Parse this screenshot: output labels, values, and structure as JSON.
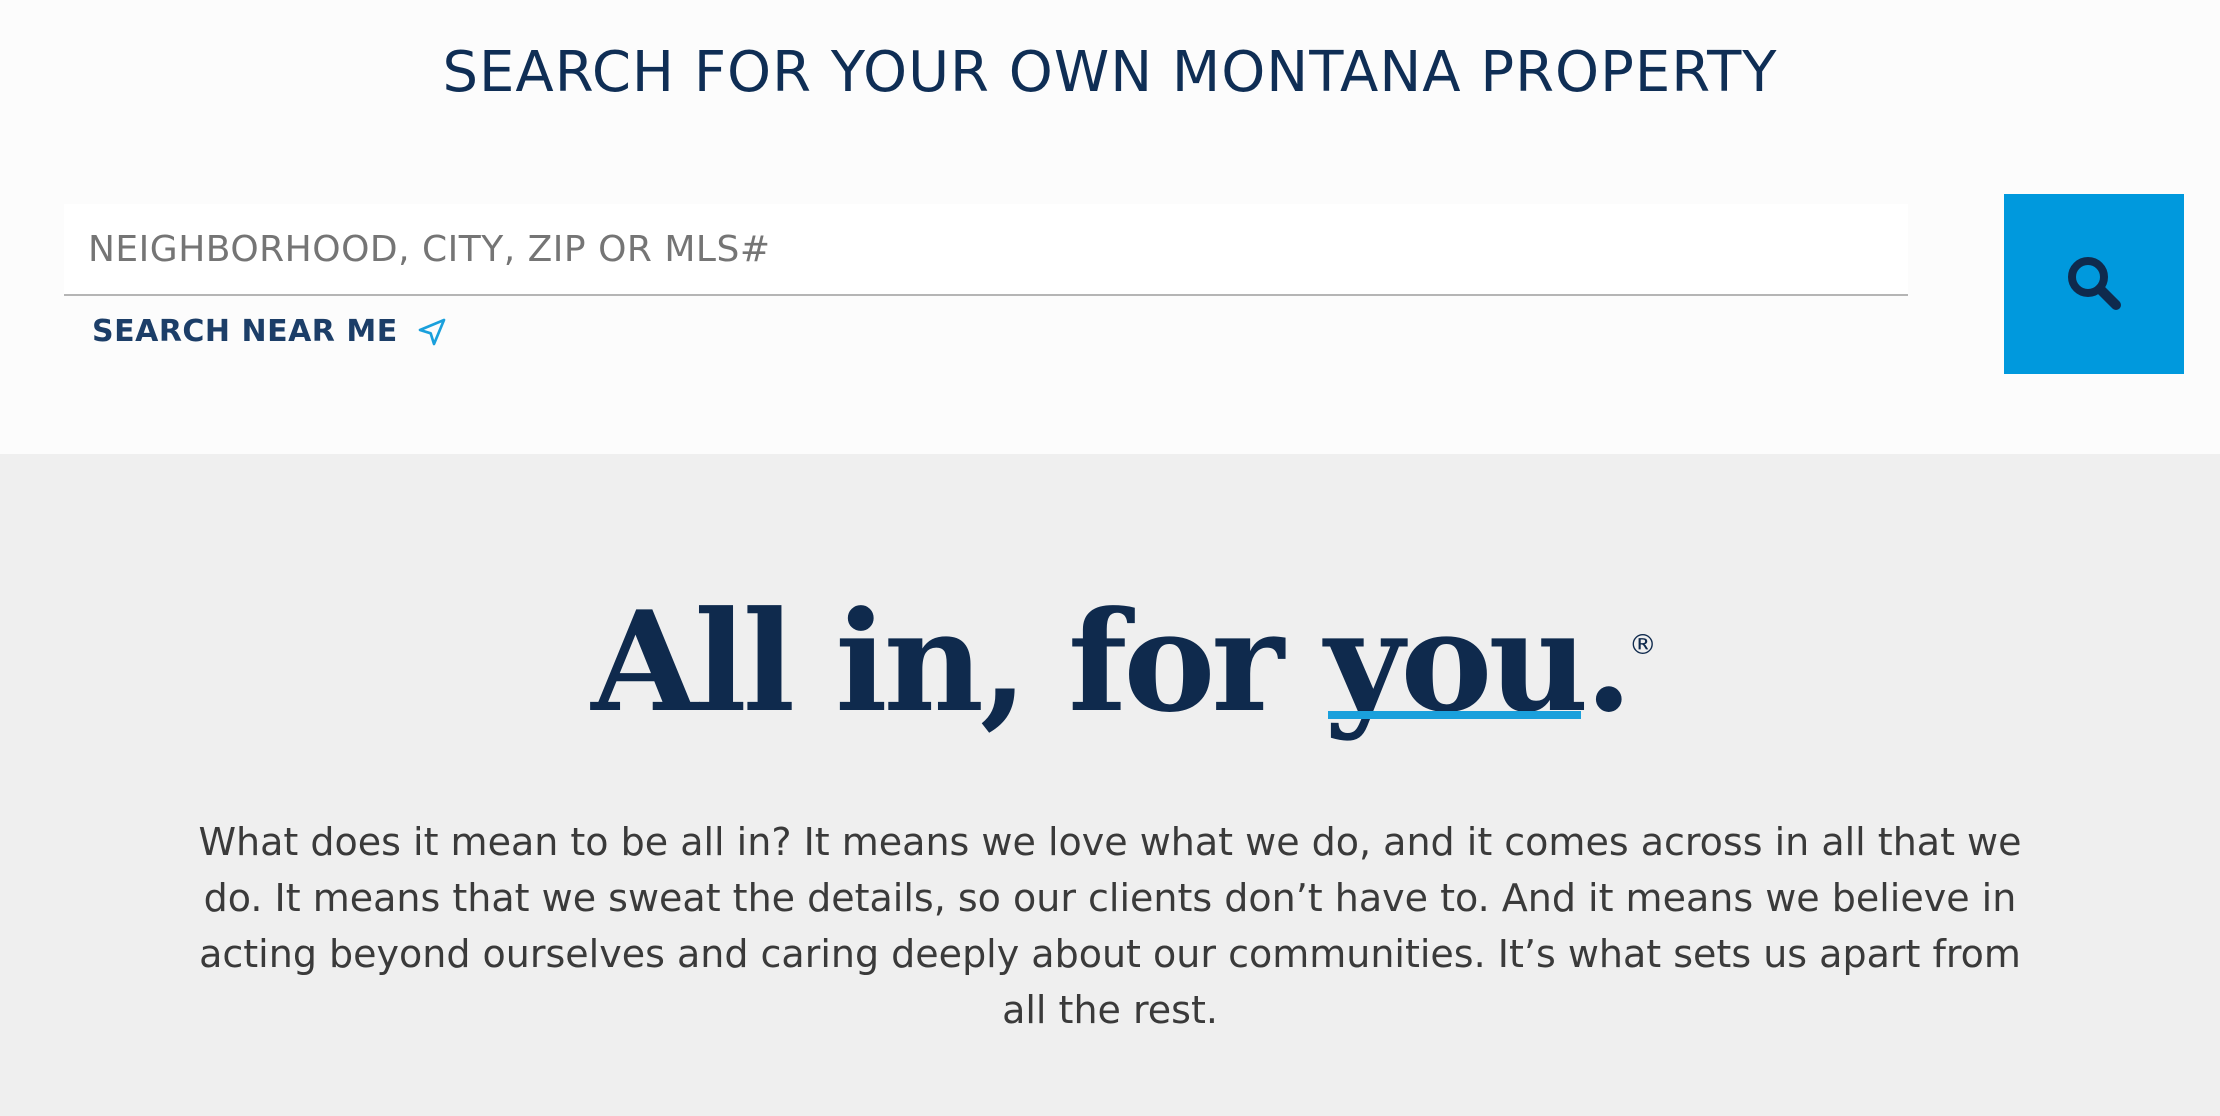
{
  "search": {
    "heading": "SEARCH FOR YOUR OWN MONTANA PROPERTY",
    "placeholder": "NEIGHBORHOOD, CITY, ZIP OR MLS#",
    "near_me_label": "SEARCH NEAR ME",
    "near_me_icon": "location-arrow-icon",
    "button_icon": "search-icon",
    "button_color": "#0099dd"
  },
  "brand": {
    "tagline_prefix": "All in, for ",
    "tagline_emphasis": "you",
    "tagline_suffix": ".",
    "registered_mark": "®",
    "accent_color": "#1aa0dc",
    "navy_color": "#0f2a4d"
  },
  "about": {
    "text": "What does it mean to be all in? It means we love what we do, and it comes across in all that we do. It means that we sweat the details, so our clients don’t have to. And it means we believe in acting beyond ourselves and caring deeply about our communities. It’s what sets us apart from all the rest."
  }
}
